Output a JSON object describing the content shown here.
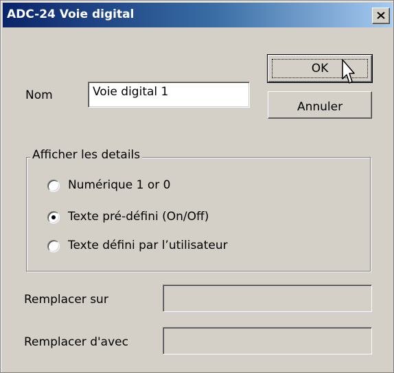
{
  "window": {
    "title": "ADC-24 Voie digital",
    "close_icon": "close-icon"
  },
  "buttons": {
    "ok_label": "OK",
    "cancel_label": "Annuler"
  },
  "name_field": {
    "label": "Nom",
    "value": "Voie digital 1"
  },
  "details_group": {
    "legend": "Afficher les details",
    "options": [
      {
        "label": "Numérique 1 or 0",
        "selected": false
      },
      {
        "label": "Texte pré-défini (On/Off)",
        "selected": true
      },
      {
        "label": "Texte défini par l’utilisateur",
        "selected": false
      }
    ]
  },
  "replace_on": {
    "label": "Remplacer sur",
    "value": ""
  },
  "replace_with": {
    "label": "Remplacer d'avec",
    "value": ""
  },
  "colors": {
    "titlebar_start": "#0a246a",
    "titlebar_end": "#a6caf0",
    "face": "#d4d0c8"
  },
  "cursor_icon": "arrow-cursor-icon"
}
